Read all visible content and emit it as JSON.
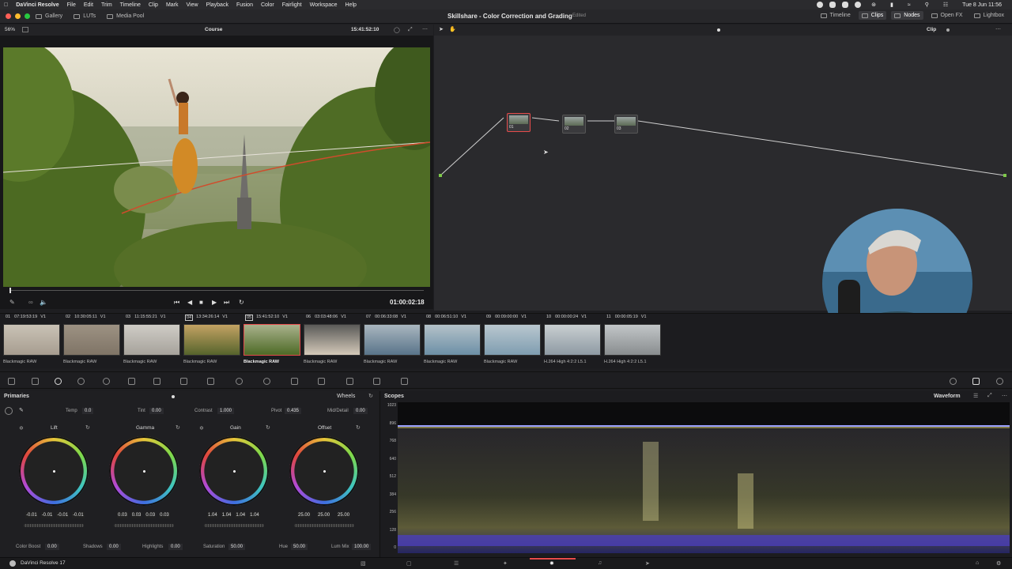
{
  "menubar": {
    "app": "DaVinci Resolve",
    "items": [
      "File",
      "Edit",
      "Trim",
      "Timeline",
      "Clip",
      "Mark",
      "View",
      "Playback",
      "Fusion",
      "Color",
      "Fairlight",
      "Workspace",
      "Help"
    ],
    "clock": "Tue 8 Jun  11:56"
  },
  "titlebar": {
    "gallery": "Gallery",
    "luts": "LUTs",
    "media_pool": "Media Pool",
    "project_title": "Skillshare - Color Correction and Grading",
    "edited": "Edited",
    "timeline": "Timeline",
    "clips": "Clips",
    "nodes": "Nodes",
    "open_fx": "Open FX",
    "lightbox": "Lightbox"
  },
  "viewer": {
    "zoom": "56%",
    "timeline_name": "Course",
    "source_tc": "15:41:52:10",
    "timecode": "01:00:02:18"
  },
  "nodes": {
    "mode": "Clip",
    "labels": [
      "01",
      "02",
      "03"
    ]
  },
  "clips": [
    {
      "num": "01",
      "tc": "07:19:53:19",
      "track": "V1",
      "codec": "Blackmagic RAW"
    },
    {
      "num": "02",
      "tc": "10:30:05:11",
      "track": "V1",
      "codec": "Blackmagic RAW"
    },
    {
      "num": "03",
      "tc": "11:15:55:21",
      "track": "V1",
      "codec": "Blackmagic RAW"
    },
    {
      "num": "04",
      "tc": "13:34:26:14",
      "track": "V1",
      "codec": "Blackmagic RAW"
    },
    {
      "num": "05",
      "tc": "15:41:52:10",
      "track": "V1",
      "codec": "Blackmagic RAW"
    },
    {
      "num": "06",
      "tc": "03:03:48:06",
      "track": "V1",
      "codec": "Blackmagic RAW"
    },
    {
      "num": "07",
      "tc": "00:06:33:08",
      "track": "V1",
      "codec": "Blackmagic RAW"
    },
    {
      "num": "08",
      "tc": "00:06:51:10",
      "track": "V1",
      "codec": "Blackmagic RAW"
    },
    {
      "num": "09",
      "tc": "00:09:00:00",
      "track": "V1",
      "codec": "Blackmagic RAW"
    },
    {
      "num": "10",
      "tc": "00:00:00:24",
      "track": "V1",
      "codec": "H.264 High 4:2:2 L5.1"
    },
    {
      "num": "11",
      "tc": "00:00:05:19",
      "track": "V1",
      "codec": "H.264 High 4:2:2 L5.1"
    }
  ],
  "primaries": {
    "title": "Primaries",
    "mode": "Wheels",
    "temp_label": "Temp",
    "temp": "0.0",
    "tint_label": "Tint",
    "tint": "0.00",
    "contrast_label": "Contrast",
    "contrast": "1.000",
    "pivot_label": "Pivot",
    "pivot": "0.435",
    "middetail_label": "Mid/Detail",
    "middetail": "0.00",
    "wheels": [
      {
        "name": "Lift",
        "vals": [
          "-0.01",
          "-0.01",
          "-0.01",
          "-0.01"
        ]
      },
      {
        "name": "Gamma",
        "vals": [
          "0.03",
          "0.03",
          "0.03",
          "0.03"
        ]
      },
      {
        "name": "Gain",
        "vals": [
          "1.04",
          "1.04",
          "1.04",
          "1.04"
        ]
      },
      {
        "name": "Offset",
        "vals": [
          "25.00",
          "25.00",
          "25.00"
        ]
      }
    ],
    "colorboost_label": "Color Boost",
    "colorboost": "0.00",
    "shadows_label": "Shadows",
    "shadows": "0.00",
    "highlights_label": "Highlights",
    "highlights": "0.00",
    "saturation_label": "Saturation",
    "saturation": "50.00",
    "hue_label": "Hue",
    "hue": "50.00",
    "lummix_label": "Lum Mix",
    "lummix": "100.00"
  },
  "scopes": {
    "title": "Scopes",
    "mode": "Waveform",
    "ticks": [
      "1023",
      "896",
      "768",
      "640",
      "512",
      "384",
      "256",
      "128",
      "0"
    ]
  },
  "bottombar": {
    "app_version": "DaVinci Resolve 17"
  },
  "colors": {
    "accent_red": "#e64b4b",
    "node_green": "#7ec94a",
    "node_blue": "#3fa4e0"
  }
}
